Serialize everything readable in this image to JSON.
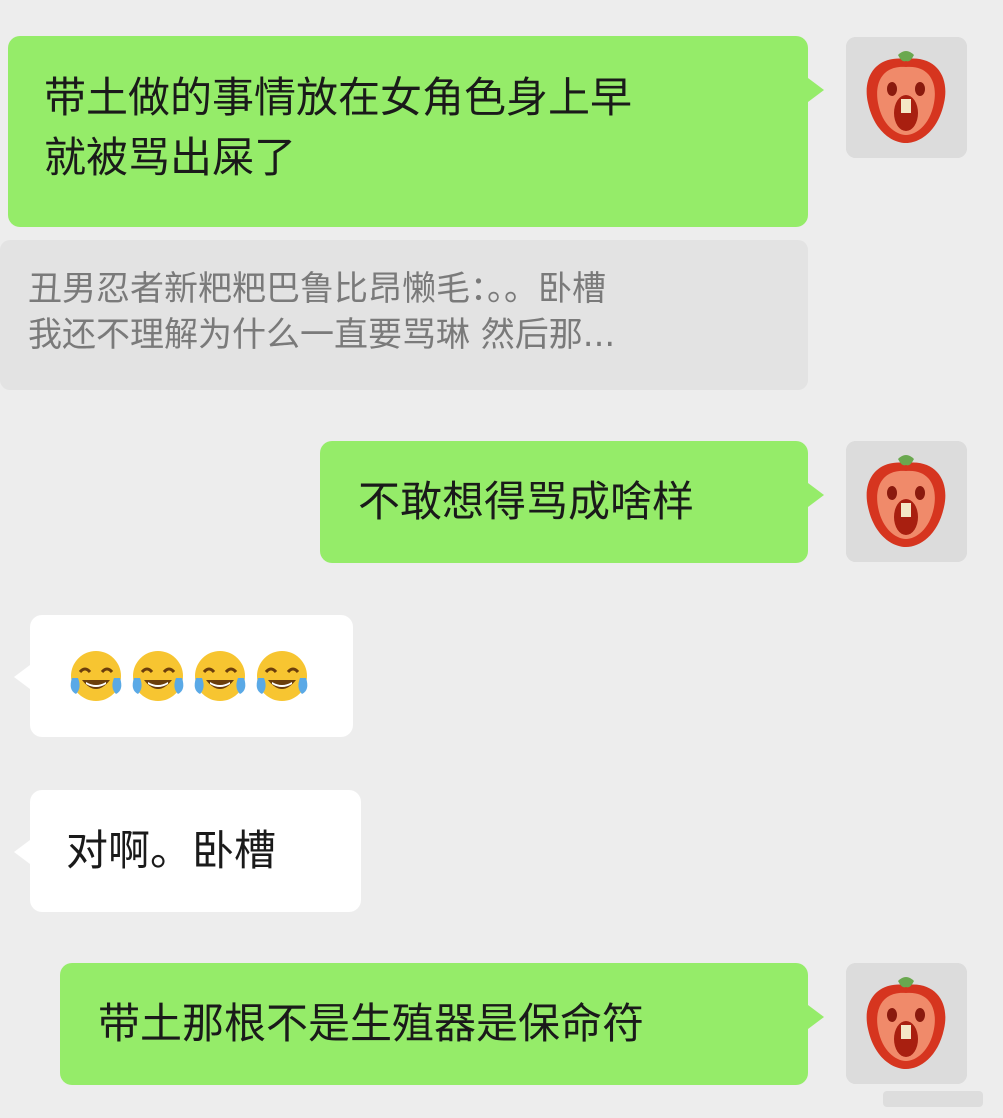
{
  "chat": {
    "messages": [
      {
        "text": "带土做的事情放在女角色身上早\n就被骂出屎了",
        "side": "right"
      },
      {
        "text": "不敢想得骂成啥样",
        "side": "right"
      },
      {
        "emoji": [
          "face-with-tears-of-joy-icon",
          "face-with-tears-of-joy-icon",
          "face-with-tears-of-joy-icon",
          "face-with-tears-of-joy-icon"
        ],
        "side": "left"
      },
      {
        "text": "对啊。卧槽",
        "side": "left"
      },
      {
        "text": "带土那根不是生殖器是保命符",
        "side": "right"
      }
    ],
    "quote": {
      "text": "丑男忍者新粑粑巴鲁比昂懒毛：。。卧槽\n我还不理解为什么一直要骂琳 然后那..."
    }
  },
  "colors": {
    "background": "#ededed",
    "bubble_green": "#95ec69",
    "bubble_white": "#ffffff",
    "quote_bg": "#e3e3e3",
    "quote_text": "#7a7a7a"
  }
}
